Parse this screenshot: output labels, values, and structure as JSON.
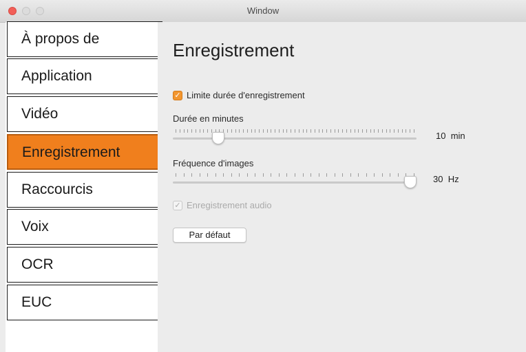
{
  "window": {
    "title": "Window"
  },
  "sidebar": {
    "items": [
      {
        "label": "À propos de"
      },
      {
        "label": "Application"
      },
      {
        "label": "Vidéo"
      },
      {
        "label": "Enregistrement",
        "active": true
      },
      {
        "label": "Raccourcis"
      },
      {
        "label": "Voix"
      },
      {
        "label": "OCR"
      },
      {
        "label": "EUC"
      }
    ]
  },
  "main": {
    "title": "Enregistrement",
    "limit_checkbox": {
      "label": "Limite durée d'enregistrement",
      "checked": true
    },
    "duration": {
      "label": "Durée en minutes",
      "value": "10",
      "unit": "min",
      "position_fraction": 0.17
    },
    "framerate": {
      "label": "Fréquence d'images",
      "value": "30",
      "unit": "Hz",
      "position_fraction": 1.0
    },
    "audio_checkbox": {
      "label": "Enregistrement audio",
      "checked": true,
      "disabled": true
    },
    "default_button": {
      "label": "Par défaut"
    }
  },
  "colors": {
    "accent": "#f07f1d",
    "checkbox": "#f29630"
  }
}
